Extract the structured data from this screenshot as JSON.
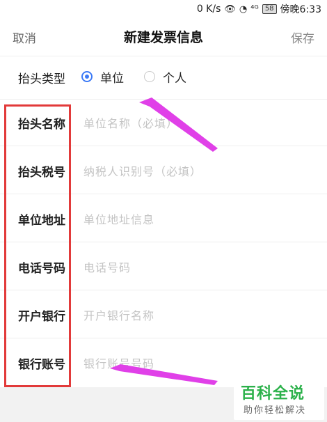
{
  "status_bar": {
    "speed": "0 K/s",
    "signal": "⁴ᴳ",
    "battery": "58",
    "time": "傍晚6:33"
  },
  "nav": {
    "cancel": "取消",
    "title": "新建发票信息",
    "save": "保存"
  },
  "header_type": {
    "label": "抬头类型",
    "option_company": "单位",
    "option_personal": "个人",
    "selected": "单位"
  },
  "fields": [
    {
      "label": "抬头名称",
      "placeholder": "单位名称（必填）"
    },
    {
      "label": "抬头税号",
      "placeholder": "纳税人识别号（必填）"
    },
    {
      "label": "单位地址",
      "placeholder": "单位地址信息"
    },
    {
      "label": "电话号码",
      "placeholder": "电话号码"
    },
    {
      "label": "开户银行",
      "placeholder": "开户银行名称"
    },
    {
      "label": "银行账号",
      "placeholder": "银行账号号码"
    }
  ],
  "watermark": {
    "title": "百科全说",
    "subtitle": "助你轻松解决"
  },
  "colors": {
    "accent": "#3d7bf6",
    "annotation_box": "#e23a3a",
    "annotation_arrow": "#e040e8",
    "watermark": "#2bb14a"
  }
}
